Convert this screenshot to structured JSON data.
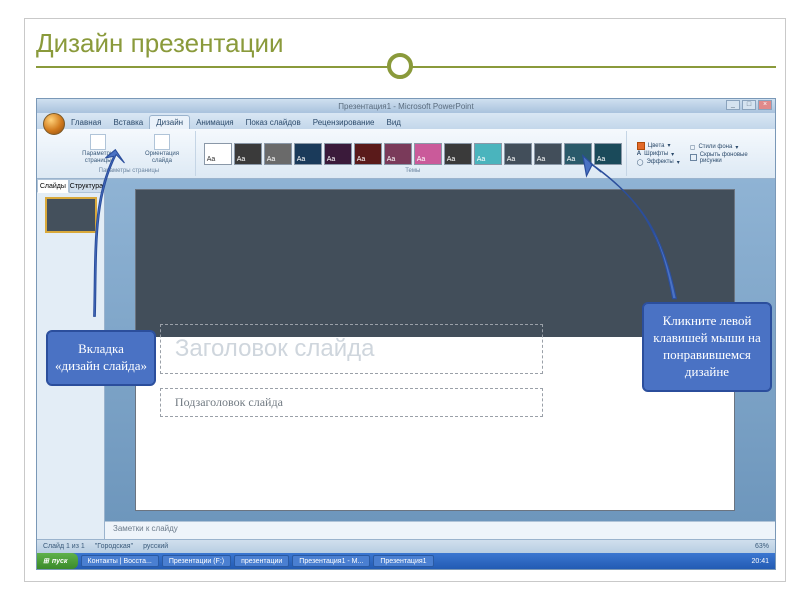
{
  "page_title": "Дизайн презентации",
  "app": {
    "window_title": "Презентация1 - Microsoft PowerPoint",
    "tabs": [
      "Главная",
      "Вставка",
      "Дизайн",
      "Анимация",
      "Показ слайдов",
      "Рецензирование",
      "Вид"
    ],
    "active_tab": "Дизайн",
    "ribbon": {
      "page_setup_group": "Параметры страницы",
      "page_params": "Параметры страницы",
      "orientation": "Ориентация слайда",
      "themes_caption": "Темы",
      "colors": "Цвета",
      "fonts": "Шрифты",
      "effects": "Эффекты",
      "bg_styles": "Стили фона",
      "hide_bg": "Скрыть фоновые рисунки"
    },
    "side_tabs": [
      "Слайды",
      "Структура"
    ],
    "slide": {
      "title_placeholder": "Заголовок слайда",
      "subtitle_placeholder": "Подзаголовок слайда"
    },
    "notes_placeholder": "Заметки к слайду",
    "status": {
      "slide_of": "Слайд 1 из 1",
      "theme": "\"Городская\"",
      "lang": "русский",
      "zoom": "63%"
    }
  },
  "taskbar": {
    "start": "пуск",
    "items": [
      "Контакты | Восста...",
      "Презентации (F:)",
      "презентации",
      "Презентация1 - М...",
      "Презентация1"
    ],
    "time": "20:41"
  },
  "callouts": {
    "left": "Вкладка «дизайн слайда»",
    "right": "Кликните левой клавишей мыши на понравившемся дизайне"
  },
  "theme_colors": [
    "#ffffff",
    "#3a3a3a",
    "#6a6a6a",
    "#1a3a5a",
    "#3a1a3a",
    "#5a1a1a",
    "#7a3a5a",
    "#ca5a9a",
    "#3a3a3a",
    "#4ab4bd",
    "#424e5a",
    "#424e5a",
    "#2a5a6a",
    "#1a4a5a"
  ]
}
